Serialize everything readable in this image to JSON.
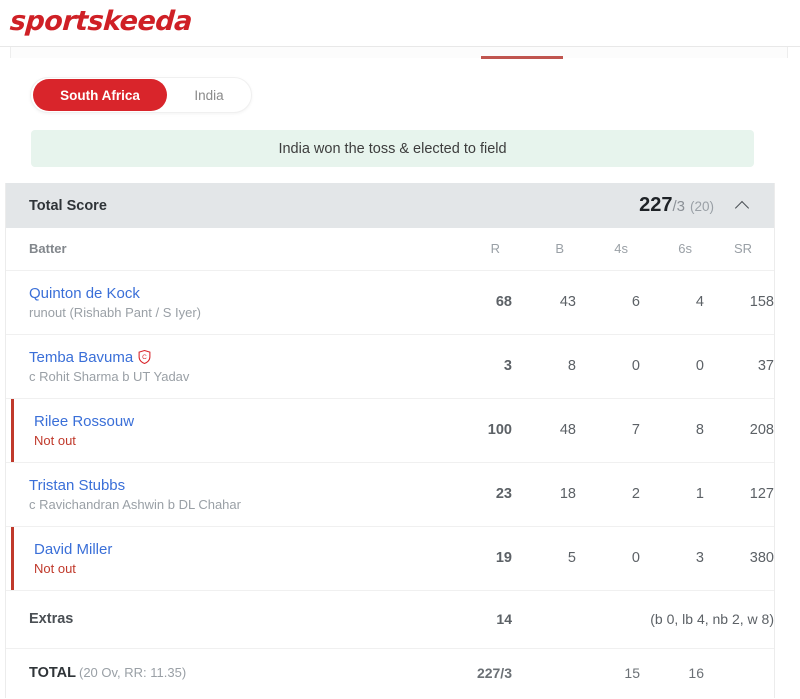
{
  "site": {
    "brand": "sportskeeda"
  },
  "teams": {
    "active": "South Africa",
    "inactive": "India"
  },
  "toss": {
    "message": "India won the toss & elected to field"
  },
  "total_score": {
    "label": "Total Score",
    "runs": "227",
    "wickets": "/3",
    "overs": "(20)",
    "collapse_icon": "chevron-up-icon"
  },
  "table": {
    "headers": {
      "batter": "Batter",
      "r": "R",
      "b": "B",
      "fours": "4s",
      "sixes": "6s",
      "sr": "SR"
    },
    "rows": [
      {
        "name": "Quinton de Kock",
        "captain": false,
        "dismissal": "runout (Rishabh Pant / S Iyer)",
        "not_out": false,
        "r": "68",
        "b": "43",
        "fours": "6",
        "sixes": "4",
        "sr": "158"
      },
      {
        "name": "Temba Bavuma",
        "captain": true,
        "dismissal": "c Rohit Sharma b UT Yadav",
        "not_out": false,
        "r": "3",
        "b": "8",
        "fours": "0",
        "sixes": "0",
        "sr": "37"
      },
      {
        "name": "Rilee Rossouw",
        "captain": false,
        "dismissal": "Not out",
        "not_out": true,
        "r": "100",
        "b": "48",
        "fours": "7",
        "sixes": "8",
        "sr": "208"
      },
      {
        "name": "Tristan Stubbs",
        "captain": false,
        "dismissal": "c Ravichandran Ashwin b DL Chahar",
        "not_out": false,
        "r": "23",
        "b": "18",
        "fours": "2",
        "sixes": "1",
        "sr": "127"
      },
      {
        "name": "David Miller",
        "captain": false,
        "dismissal": "Not out",
        "not_out": true,
        "r": "19",
        "b": "5",
        "fours": "0",
        "sixes": "3",
        "sr": "380"
      }
    ],
    "extras": {
      "label": "Extras",
      "value": "14",
      "breakdown": "(b 0, lb 4, nb 2, w 8)"
    },
    "total": {
      "label": "TOTAL",
      "sub": "(20 Ov, RR: 11.35)",
      "value": "227/3",
      "fours": "15",
      "sixes": "16"
    }
  },
  "colors": {
    "brand_red": "#cf2026",
    "accent_red": "#d9252b",
    "link_blue": "#3a6fd8",
    "notout_red": "#c0392b",
    "toss_bg": "#e7f4ed",
    "total_bar_bg": "#e3e6e8"
  }
}
